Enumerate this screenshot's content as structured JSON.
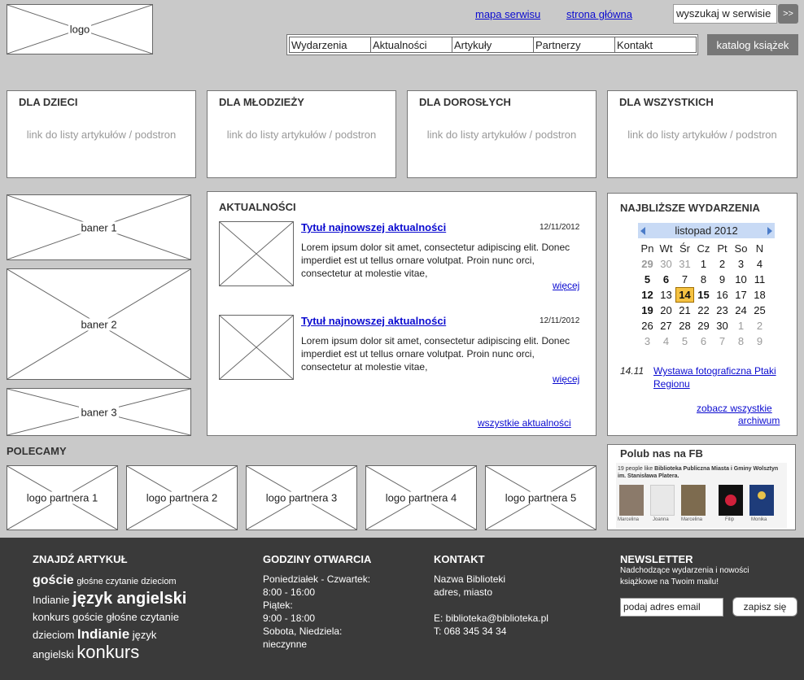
{
  "header": {
    "logo": "logo",
    "links": {
      "sitemap": "mapa serwisu",
      "home": "strona główna"
    },
    "search": {
      "value": "wyszukaj w serwisie",
      "button": ">>"
    },
    "nav": [
      "Wydarzenia",
      "Aktualności",
      "Artykuły",
      "Partnerzy",
      "Kontakt"
    ],
    "catalog_button": "katalog książek"
  },
  "categories": [
    {
      "title": "DLA DZIECI",
      "sub": "link do listy artykułów / podstron"
    },
    {
      "title": "DLA MŁODZIEŻY",
      "sub": "link do listy artykułów / podstron"
    },
    {
      "title": "DLA DOROSŁYCH",
      "sub": "link do listy artykułów / podstron"
    },
    {
      "title": "DLA WSZYSTKICH",
      "sub": "link do listy artykułów / podstron"
    }
  ],
  "banners": [
    "baner 1",
    "baner 2",
    "baner 3"
  ],
  "news": {
    "title": "AKTUALNOŚCI",
    "items": [
      {
        "title": "Tytuł najnowszej aktualności",
        "date": "12/11/2012",
        "text": "Lorem ipsum dolor sit amet, consectetur adipiscing elit. Donec imperdiet est ut tellus ornare volutpat. Proin nunc orci, consectetur at molestie vitae,",
        "more": "więcej"
      },
      {
        "title": "Tytuł najnowszej aktualności",
        "date": "12/11/2012",
        "text": "Lorem ipsum dolor sit amet, consectetur adipiscing elit. Donec imperdiet est ut tellus ornare volutpat. Proin nunc orci, consectetur at molestie vitae,",
        "more": "więcej"
      }
    ],
    "all_link": "wszystkie aktualności"
  },
  "events": {
    "title": "NAJBLIŻSZE WYDARZENIA",
    "calendar": {
      "month": "listopad 2012",
      "dow": [
        "Pn",
        "Wt",
        "Śr",
        "Cz",
        "Pt",
        "So",
        "N"
      ],
      "weeks": [
        [
          "29",
          "30",
          "31",
          "1",
          "2",
          "3",
          "4"
        ],
        [
          "5",
          "6",
          "7",
          "8",
          "9",
          "10",
          "11"
        ],
        [
          "12",
          "13",
          "14",
          "15",
          "16",
          "17",
          "18"
        ],
        [
          "19",
          "20",
          "21",
          "22",
          "23",
          "24",
          "25"
        ],
        [
          "26",
          "27",
          "28",
          "29",
          "30",
          "1",
          "2"
        ],
        [
          "3",
          "4",
          "5",
          "6",
          "7",
          "8",
          "9"
        ]
      ]
    },
    "event": {
      "date": "14.11",
      "title": "Wystawa fotograficzna Ptaki Regionu"
    },
    "see_all": "zobacz wszystkie",
    "archive": "archiwum"
  },
  "recommended": {
    "title": "POLECAMY",
    "partners": [
      "logo partnera 1",
      "logo partnera 2",
      "logo partnera 3",
      "logo partnera 4",
      "logo partnera 5"
    ]
  },
  "facebook": {
    "title": "Polub nas na FB",
    "count_text": "19 people like",
    "page_name": "Biblioteka Publiczna Miasta i Gminy Wolsztyn im. Stanisława Platera.",
    "people": [
      "Marcelina",
      "Joanna",
      "Marcelina",
      "Filip",
      "Monika"
    ]
  },
  "footer": {
    "find": {
      "title": "ZNAJDŹ ARTYKUŁ",
      "tags": [
        "goście",
        "głośne czytanie dzieciom",
        "Indianie",
        "język angielski",
        "konkurs",
        "goście",
        "głośne czytanie",
        "dzieciom",
        "Indianie",
        "język",
        "angielski",
        "konkurs"
      ]
    },
    "hours": {
      "title": "GODZINY OTWARCIA",
      "lines": [
        "Poniedziałek - Czwartek:",
        "8:00 - 16:00",
        "Piątek:",
        "9:00 - 18:00",
        "Sobota, Niedziela:",
        "nieczynne"
      ]
    },
    "contact": {
      "title": "KONTAKT",
      "name": "Nazwa Biblioteki",
      "address": "adres, miasto",
      "email": "E: biblioteka@biblioteka.pl",
      "phone": "T: 068 345 34 34"
    },
    "newsletter": {
      "title": "NEWSLETTER",
      "text": "Nadchodzące wydarzenia i nowości książkowe na Twoim mailu!",
      "input": "podaj adres email",
      "button": "zapisz się"
    }
  },
  "colors": {
    "background": "#c9c9c9",
    "footer": "#3a3a3a",
    "link": "#0b0bd0",
    "today": "#f5c242",
    "calendar_header": "#c8daf5"
  }
}
